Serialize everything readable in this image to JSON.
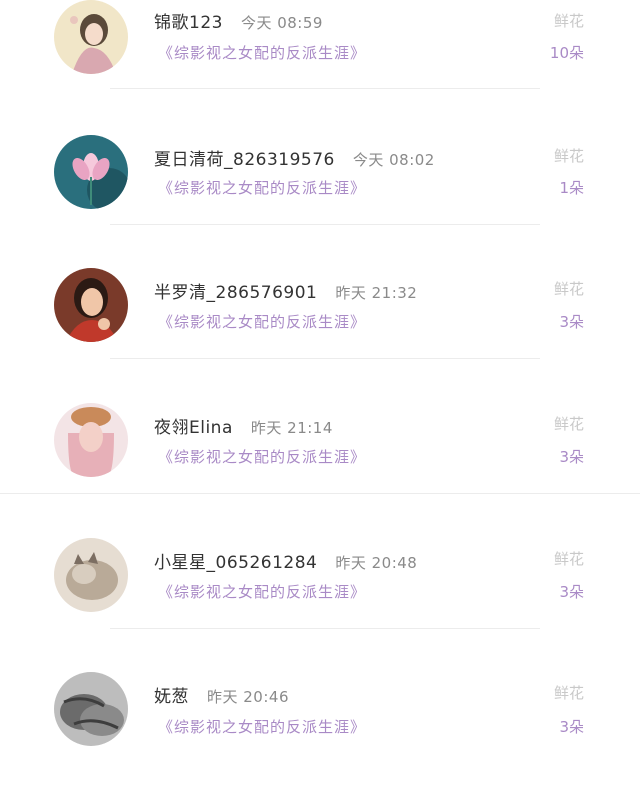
{
  "entries": [
    {
      "name": "锦歌123",
      "time": "今天 08:59",
      "book": "《综影视之女配的反派生涯》",
      "gift": "鲜花",
      "count": "10朵",
      "avatar_colors": [
        "#f1e6c8",
        "#d9a8b0",
        "#5b4a3a"
      ]
    },
    {
      "name": "夏日清荷_826319576",
      "time": "今天 08:02",
      "book": "《综影视之女配的反派生涯》",
      "gift": "鲜花",
      "count": "1朵",
      "avatar_colors": [
        "#2a6f7d",
        "#e9a4c3",
        "#9fd1d6"
      ]
    },
    {
      "name": "半罗清_286576901",
      "time": "昨天 21:32",
      "book": "《综影视之女配的反派生涯》",
      "gift": "鲜花",
      "count": "3朵",
      "avatar_colors": [
        "#7a3a2a",
        "#f0c6a8",
        "#c0392b"
      ]
    },
    {
      "name": "夜翎Elina",
      "time": "昨天 21:14",
      "book": "《综影视之女配的反派生涯》",
      "gift": "鲜花",
      "count": "3朵",
      "avatar_colors": [
        "#c98a5a",
        "#f3d0c8",
        "#e7b0b8"
      ]
    },
    {
      "name": "小星星_065261284",
      "time": "昨天 20:48",
      "book": "《综影视之女配的反派生涯》",
      "gift": "鲜花",
      "count": "3朵",
      "avatar_colors": [
        "#b9aa98",
        "#e6ddd2",
        "#7c6e62"
      ]
    },
    {
      "name": "妩葱",
      "time": "昨天 20:46",
      "book": "《综影视之女配的反派生涯》",
      "gift": "鲜花",
      "count": "3朵",
      "avatar_colors": [
        "#6b6b6b",
        "#bdbdbd",
        "#3d3d3d"
      ]
    }
  ]
}
